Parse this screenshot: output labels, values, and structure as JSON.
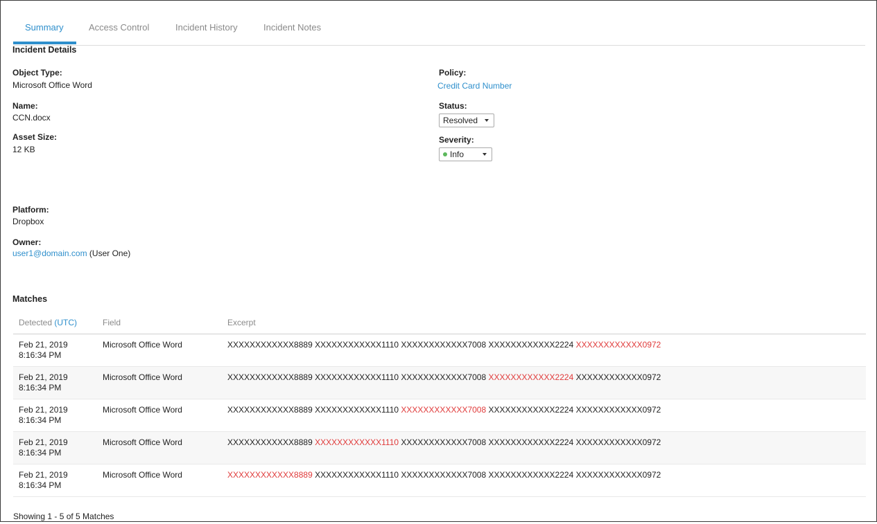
{
  "tabs": [
    {
      "label": "Summary",
      "active": true
    },
    {
      "label": "Access Control",
      "active": false
    },
    {
      "label": "Incident History",
      "active": false
    },
    {
      "label": "Incident Notes",
      "active": false
    }
  ],
  "incident_details": {
    "title": "Incident Details",
    "object_type": {
      "label": "Object Type:",
      "value": "Microsoft Office Word"
    },
    "name": {
      "label": "Name:",
      "value": "CCN.docx"
    },
    "asset_size": {
      "label": "Asset Size:",
      "value": "12 KB"
    },
    "platform": {
      "label": "Platform:",
      "value": "Dropbox"
    },
    "owner": {
      "label": "Owner:",
      "email": "user1@domain.com",
      "display_name": "(User One)"
    },
    "policy": {
      "label": "Policy:",
      "value": "Credit Card Number"
    },
    "status": {
      "label": "Status:",
      "selected": "Resolved"
    },
    "severity": {
      "label": "Severity:",
      "selected": "Info",
      "indicator_color": "#5cb85c"
    }
  },
  "matches": {
    "title": "Matches",
    "columns": {
      "detected": "Detected",
      "detected_tz": "(UTC)",
      "field": "Field",
      "excerpt": "Excerpt"
    },
    "rows": [
      {
        "date": "Feb 21, 2019",
        "time": "8:16:34 PM",
        "field": "Microsoft Office Word",
        "excerpt_parts": [
          "XXXXXXXXXXXX8889",
          "XXXXXXXXXXXX1110",
          "XXXXXXXXXXXX7008",
          "XXXXXXXXXXXX2224",
          "XXXXXXXXXXXX0972"
        ],
        "highlight_index": 4
      },
      {
        "date": "Feb 21, 2019",
        "time": "8:16:34 PM",
        "field": "Microsoft Office Word",
        "excerpt_parts": [
          "XXXXXXXXXXXX8889",
          "XXXXXXXXXXXX1110",
          "XXXXXXXXXXXX7008",
          "XXXXXXXXXXXX2224",
          "XXXXXXXXXXXX0972"
        ],
        "highlight_index": 3
      },
      {
        "date": "Feb 21, 2019",
        "time": "8:16:34 PM",
        "field": "Microsoft Office Word",
        "excerpt_parts": [
          "XXXXXXXXXXXX8889",
          "XXXXXXXXXXXX1110",
          "XXXXXXXXXXXX7008",
          "XXXXXXXXXXXX2224",
          "XXXXXXXXXXXX0972"
        ],
        "highlight_index": 2
      },
      {
        "date": "Feb 21, 2019",
        "time": "8:16:34 PM",
        "field": "Microsoft Office Word",
        "excerpt_parts": [
          "XXXXXXXXXXXX8889",
          "XXXXXXXXXXXX1110",
          "XXXXXXXXXXXX7008",
          "XXXXXXXXXXXX2224",
          "XXXXXXXXXXXX0972"
        ],
        "highlight_index": 1
      },
      {
        "date": "Feb 21, 2019",
        "time": "8:16:34 PM",
        "field": "Microsoft Office Word",
        "excerpt_parts": [
          "XXXXXXXXXXXX8889",
          "XXXXXXXXXXXX1110",
          "XXXXXXXXXXXX7008",
          "XXXXXXXXXXXX2224",
          "XXXXXXXXXXXX0972"
        ],
        "highlight_index": 0
      }
    ],
    "footer": "Showing 1 - 5 of 5 Matches"
  },
  "colors": {
    "accent": "#2e8fcc",
    "highlight": "#e03a3a",
    "row_alt": "#f7f7f7"
  }
}
